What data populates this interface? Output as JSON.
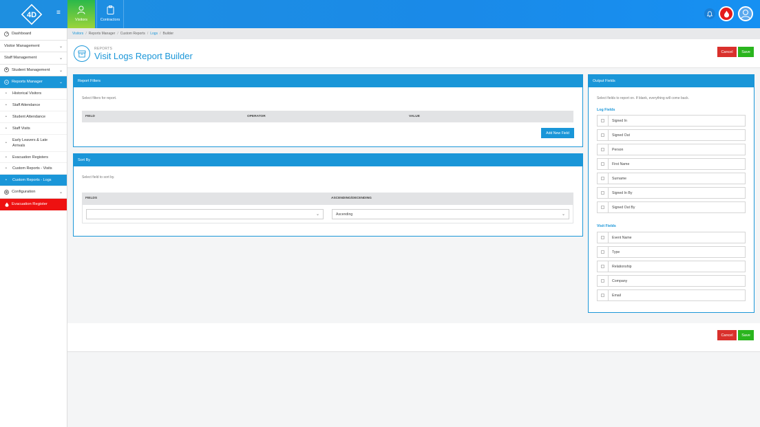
{
  "topbar": {
    "logo_text": "4D",
    "tabs": [
      {
        "label": "Visitors",
        "icon": "person-icon"
      },
      {
        "label": "Contractors",
        "icon": "clipboard-icon"
      }
    ]
  },
  "sidebar": {
    "items": [
      {
        "label": "Dashboard",
        "icon": "dashboard-icon"
      },
      {
        "label": "Visitor Management"
      },
      {
        "label": "Staff Management"
      },
      {
        "label": "Student Management",
        "icon": "student-icon"
      },
      {
        "label": "Reports Manager",
        "icon": "reports-icon"
      },
      {
        "label": "Configuration",
        "icon": "gear-icon"
      },
      {
        "label": "Evacuation Register",
        "icon": "flame-icon"
      }
    ],
    "subitems": [
      "Historical Visitors",
      "Staff Attendance",
      "Student Attendance",
      "Staff Visits",
      "Early Leavers & Late Arrivals",
      "Evacuation Registers",
      "Custom Reports - Visits",
      "Custom Reports - Logs"
    ]
  },
  "breadcrumb": [
    "Visitors",
    "Reports Manager",
    "Custom Reports",
    "Logs",
    "Builder"
  ],
  "header": {
    "overline": "REPORTS",
    "title": "Visit Logs Report Builder",
    "cancel_label": "Cancel",
    "save_label": "Save"
  },
  "filters": {
    "title": "Report Filters",
    "hint": "Select filters for report.",
    "columns": [
      "FIELD",
      "OPERATOR",
      "VALUE"
    ],
    "add_label": "Add New Field"
  },
  "sort": {
    "title": "Sort By",
    "hint": "Select field to sort by.",
    "columns": [
      "FIELDS",
      "ASCENDING/DECENDING"
    ],
    "field_value": "",
    "order_value": "Ascending"
  },
  "output": {
    "title": "Output Fields",
    "hint": "Select fields to report on. If blank, everything will come back.",
    "log_group": "Log Fields",
    "log_fields": [
      "Signed In",
      "Signed Out",
      "Person",
      "First Name",
      "Surname",
      "Signed In By",
      "Signed Out By"
    ],
    "visit_group": "Visit Fields",
    "visit_fields": [
      "Event Name",
      "Type",
      "Relationship",
      "Company",
      "Email"
    ]
  },
  "footer": {
    "cancel_label": "Cancel",
    "save_label": "Save"
  },
  "colors": {
    "primary": "#1a96d8",
    "cancel": "#d9302c",
    "save": "#2ab51e",
    "evac": "#ee1111"
  }
}
